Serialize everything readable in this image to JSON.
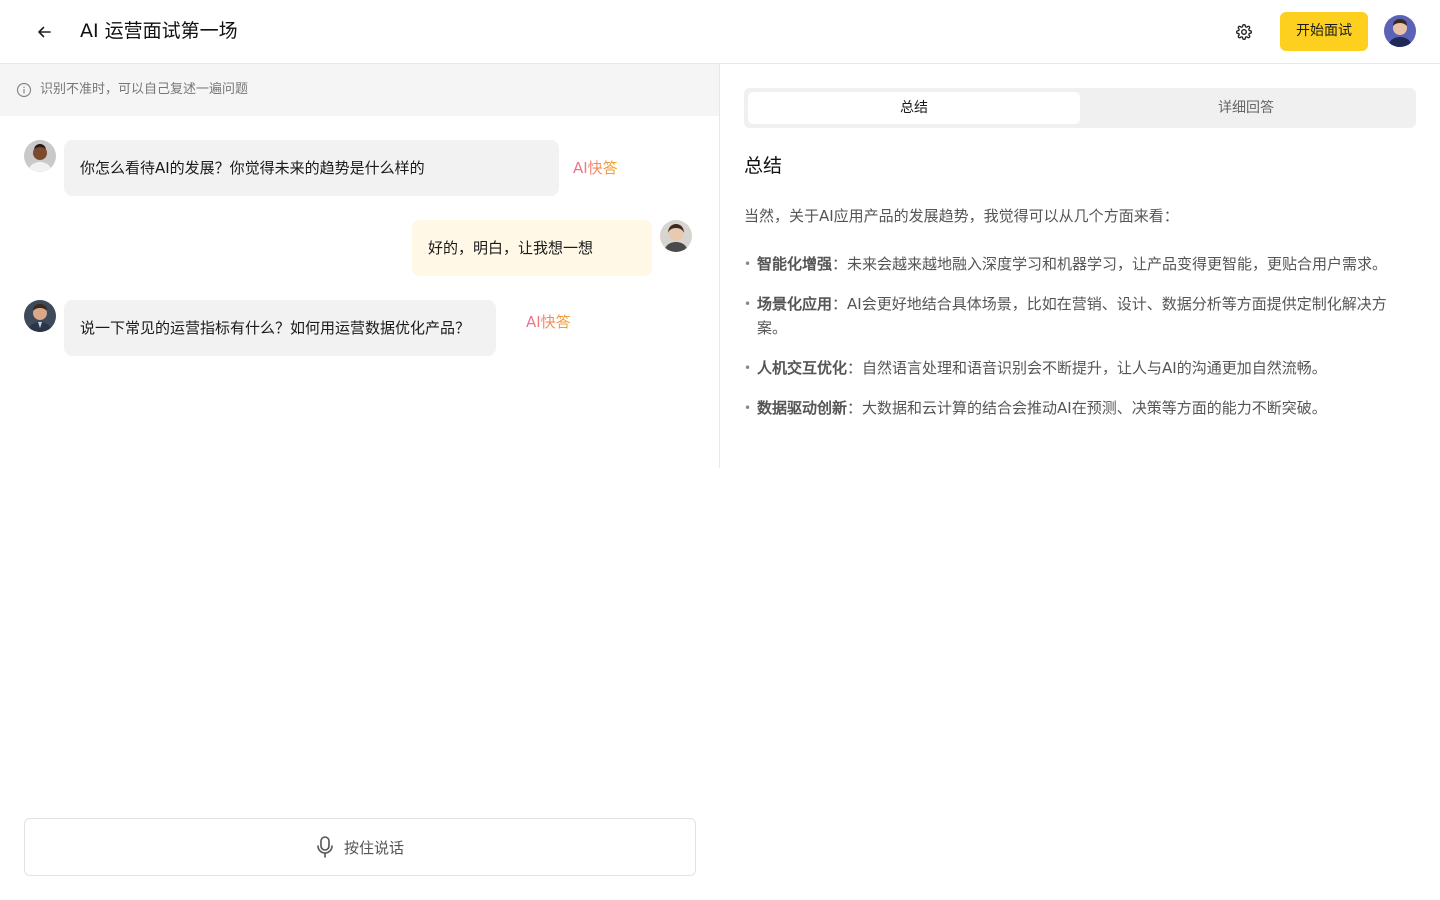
{
  "header": {
    "title": "AI 运营面试第一场",
    "start_label": "开始面试"
  },
  "notice": {
    "text": "识别不准时，可以自己复述一遍问题"
  },
  "chat": {
    "messages": [
      {
        "role": "interviewer",
        "text": "你怎么看待AI的发展？你觉得未来的趋势是什么样的",
        "ai_label": "AI快答"
      },
      {
        "role": "candidate",
        "text": "好的，明白，让我想一想"
      },
      {
        "role": "interviewer",
        "text": "说一下常见的运营指标有什么？如何用运营数据优化产品？",
        "ai_label": "AI快答"
      }
    ]
  },
  "talk_button": {
    "label": "按住说话"
  },
  "panel": {
    "tabs": [
      {
        "label": "总结",
        "active": true
      },
      {
        "label": "详细回答",
        "active": false
      }
    ],
    "heading": "总结",
    "intro": "当然，关于AI应用产品的发展趋势，我觉得可以从几个方面来看：",
    "points": [
      {
        "title": "智能化增强",
        "text": "：未来会越来越地融入深度学习和机器学习，让产品变得更智能，更贴合用户需求。"
      },
      {
        "title": "场景化应用",
        "text": "：AI会更好地结合具体场景，比如在营销、设计、数据分析等方面提供定制化解决方案。"
      },
      {
        "title": "人机交互优化",
        "text": "：自然语言处理和语音识别会不断提升，让人与AI的沟通更加自然流畅。"
      },
      {
        "title": "数据驱动创新",
        "text": "：大数据和云计算的结合会推动AI在预测、决策等方面的能力不断突破。"
      }
    ]
  },
  "colors": {
    "accent": "#fdd020",
    "ai_gradient_start": "#ec6b9d",
    "ai_gradient_end": "#f5a623",
    "answer_bubble": "#fff8e6",
    "question_bubble": "#f2f2f2"
  },
  "icons": [
    "back-arrow-icon",
    "gear-icon",
    "info-icon",
    "microphone-icon"
  ]
}
